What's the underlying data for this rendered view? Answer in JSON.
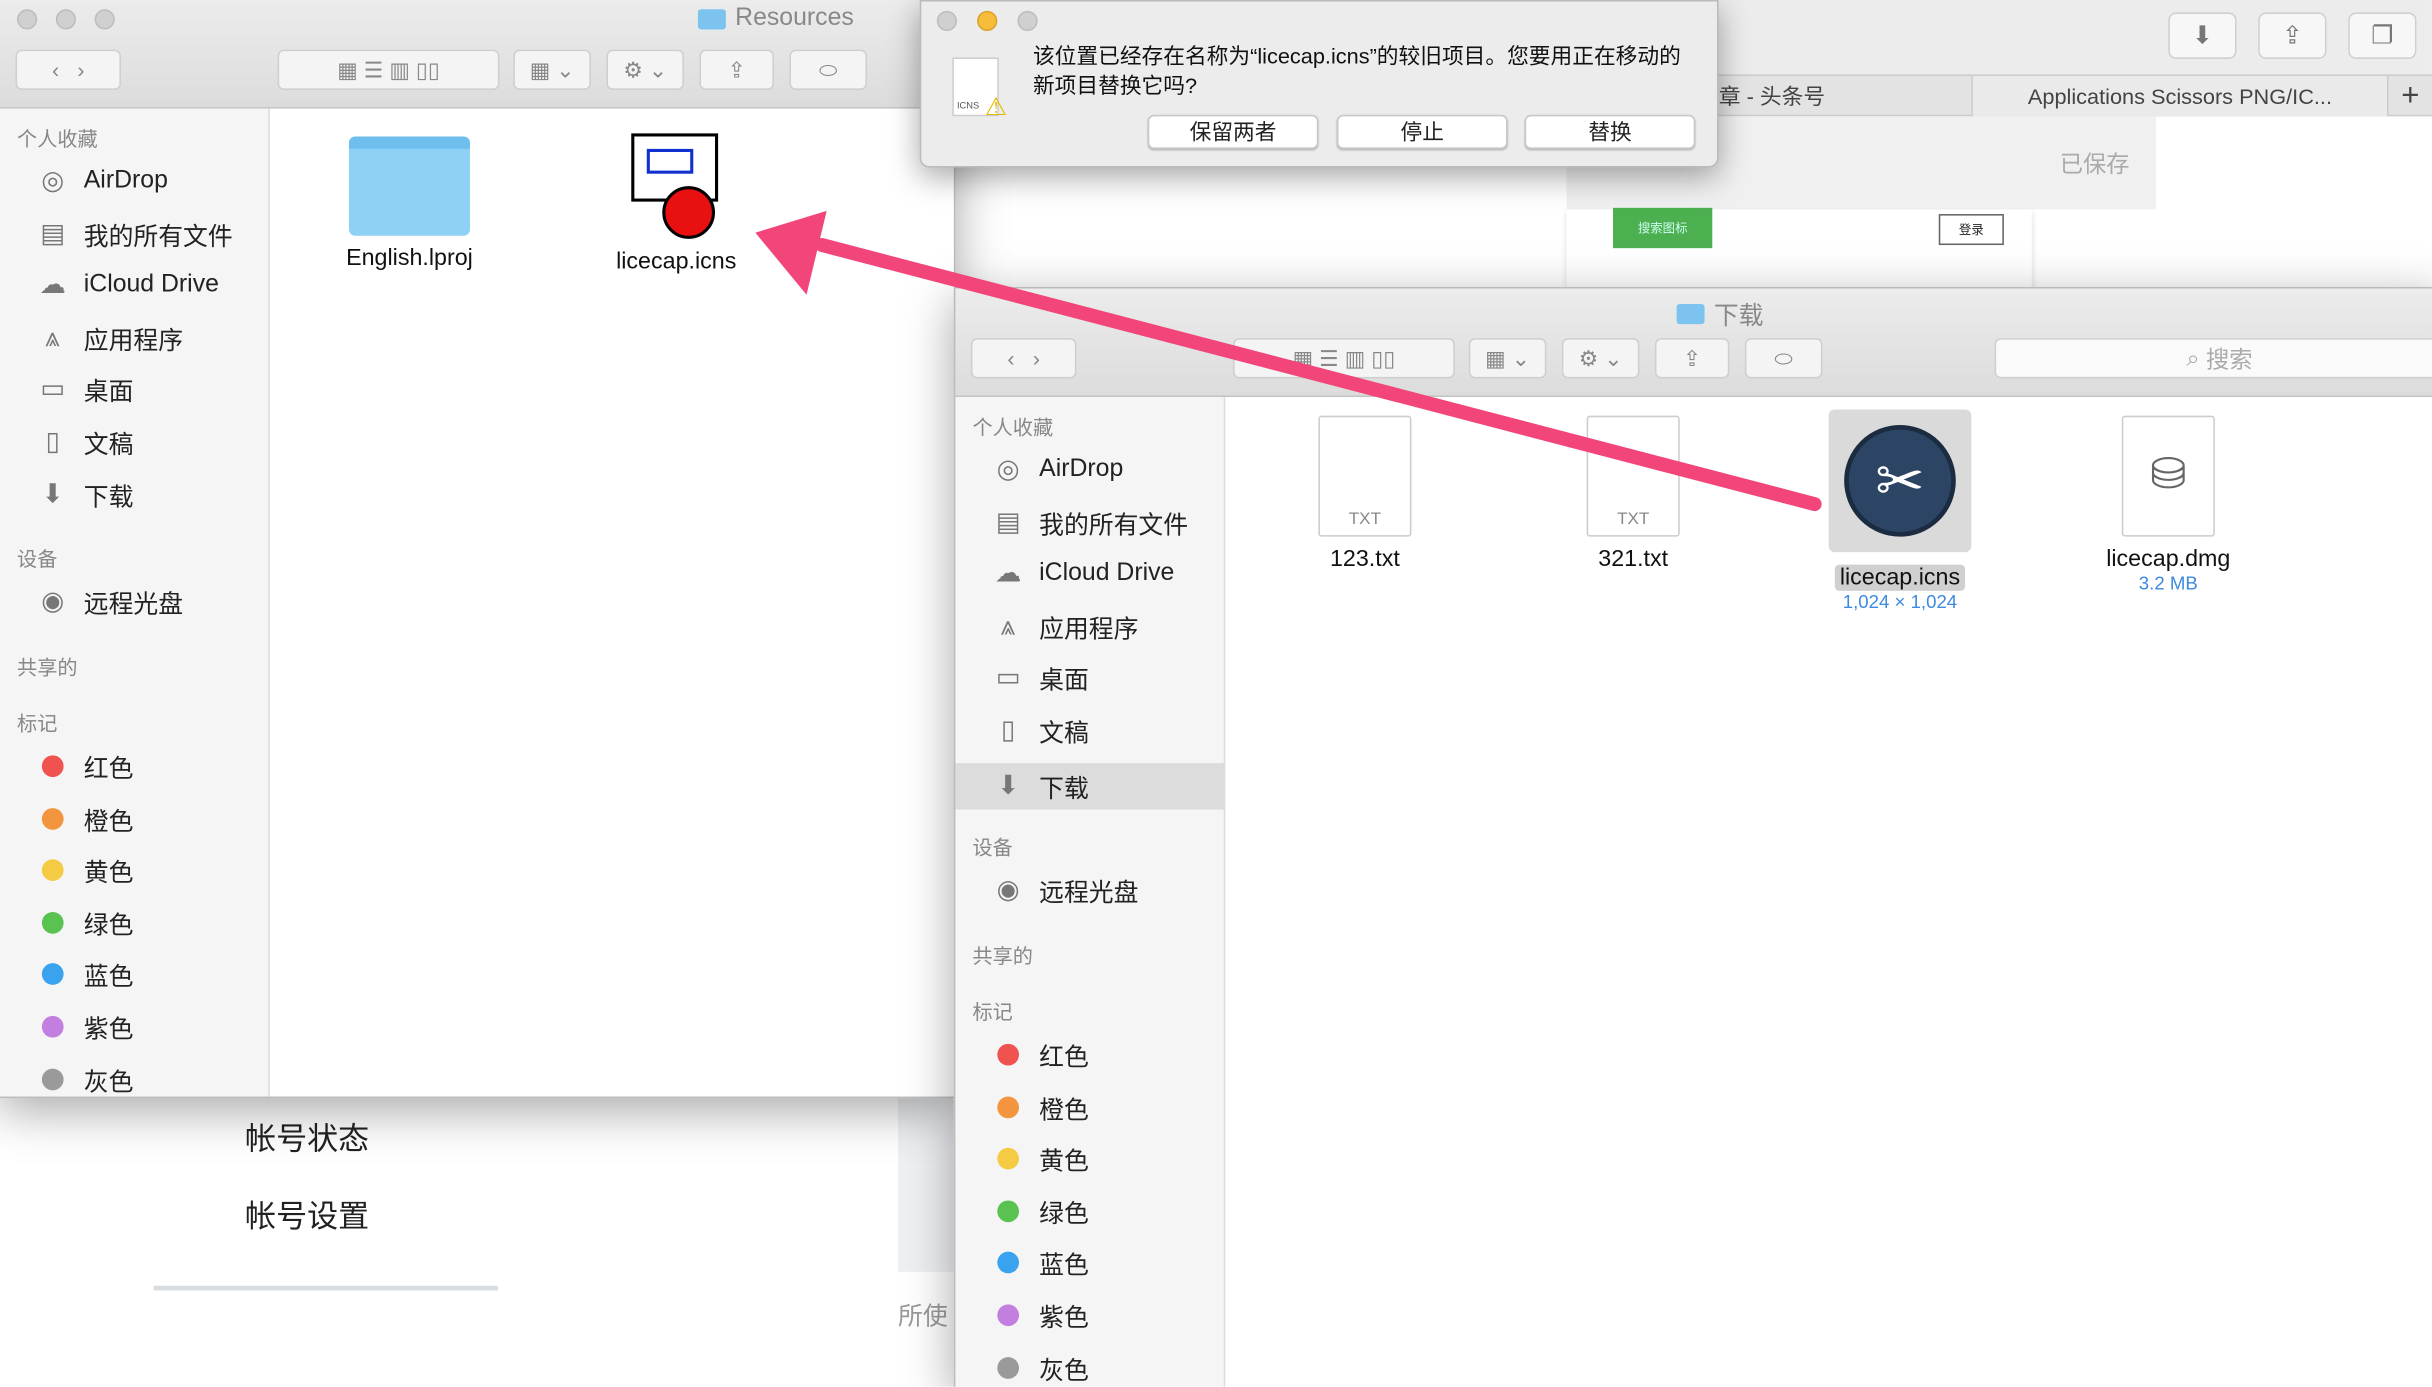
{
  "browser": {
    "tabs": [
      "文章 - 头条号",
      "Applications Scissors PNG/IC..."
    ],
    "new_tab": "+",
    "saved": "已保存",
    "green_button": "搜索图标",
    "login": "登录",
    "account_status": "帐号状态",
    "account_settings": "帐号设置",
    "partial_text": "所使"
  },
  "dialog": {
    "message": "该位置已经存在名称为“licecap.icns”的较旧项目。您要用正在移动的新项目替换它吗?",
    "keep_both": "保留两者",
    "stop": "停止",
    "replace": "替换",
    "icon_label": "ICNS"
  },
  "left_finder": {
    "title": "Resources",
    "files": [
      {
        "name": "English.lproj"
      },
      {
        "name": "licecap.icns"
      }
    ]
  },
  "right_finder": {
    "title": "下载",
    "search_placeholder": "搜索",
    "selected": "下载",
    "files": [
      {
        "name": "123.txt",
        "type": "TXT"
      },
      {
        "name": "321.txt",
        "type": "TXT"
      },
      {
        "name": "licecap.icns",
        "sub": "1,024 × 1,024"
      },
      {
        "name": "licecap.dmg",
        "sub": "3.2 MB"
      }
    ]
  },
  "sidebar": {
    "favorites": "个人收藏",
    "items": [
      "AirDrop",
      "我的所有文件",
      "iCloud Drive",
      "应用程序",
      "桌面",
      "文稿",
      "下载"
    ],
    "devices": "设备",
    "device_items": [
      "远程光盘"
    ],
    "shared": "共享的",
    "tags_header": "标记",
    "tags": [
      {
        "name": "红色",
        "color": "#f0524f"
      },
      {
        "name": "橙色",
        "color": "#f3953f"
      },
      {
        "name": "黄色",
        "color": "#f6cb44"
      },
      {
        "name": "绿色",
        "color": "#5ac251"
      },
      {
        "name": "蓝色",
        "color": "#3aa3ef"
      },
      {
        "name": "紫色",
        "color": "#c37fe0"
      },
      {
        "name": "灰色",
        "color": "#9a9a9a"
      }
    ]
  },
  "arrow_color": "#f2457a"
}
